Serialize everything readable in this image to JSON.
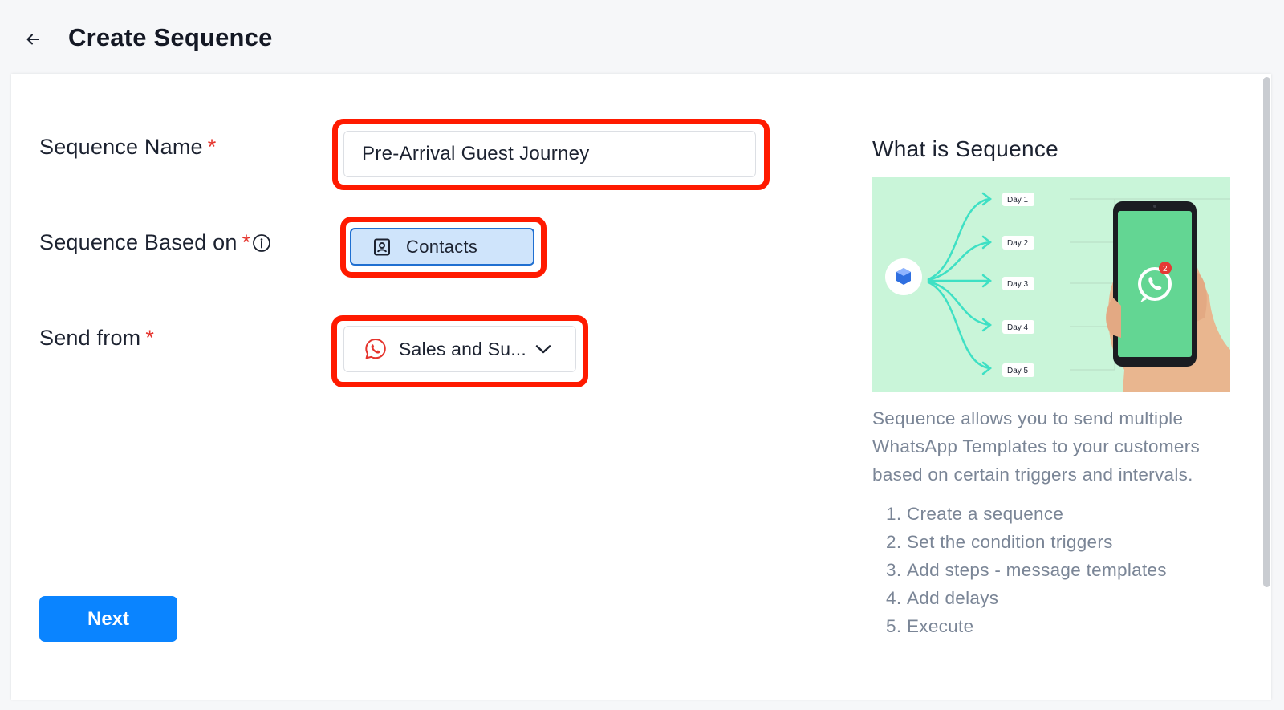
{
  "header": {
    "title": "Create Sequence",
    "back_icon": "arrow-left-icon"
  },
  "form": {
    "name_label": "Sequence Name",
    "name_value": "Pre-Arrival Guest Journey",
    "based_on_label": "Sequence Based on",
    "based_on_option": "Contacts",
    "send_from_label": "Send from",
    "send_from_value": "Sales and Su...",
    "required_mark": "*",
    "next_label": "Next"
  },
  "sidebar": {
    "title": "What is Sequence",
    "days": [
      "Day 1",
      "Day 2",
      "Day 3",
      "Day 4",
      "Day 5"
    ],
    "badge_count": "2",
    "description": "Sequence allows you to send multiple WhatsApp Templates to your customers based on certain triggers and intervals.",
    "steps": [
      {
        "num": "1.",
        "text": "Create a sequence"
      },
      {
        "num": "2.",
        "text": "Set the condition triggers"
      },
      {
        "num": "3.",
        "text": "Add steps - message templates"
      },
      {
        "num": "4.",
        "text": "Add delays"
      },
      {
        "num": "5.",
        "text": "Execute"
      }
    ]
  },
  "colors": {
    "highlight": "#ff1a00",
    "primary": "#0a84ff",
    "required": "#e5342d",
    "illustration_bg": "#c9f5d9",
    "whatsapp_green": "#25d366"
  }
}
